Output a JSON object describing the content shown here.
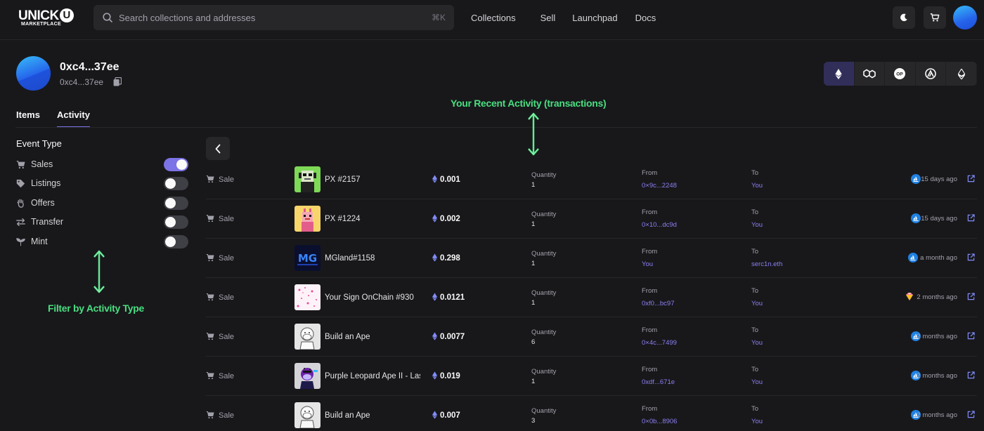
{
  "header": {
    "logo_main": "UNICK",
    "logo_u": "U",
    "logo_sub": "MARKETPLACE",
    "search_placeholder": "Search collections and addresses",
    "search_shortcut": "⌘K",
    "nav": [
      "Collections",
      "Sell",
      "Launchpad",
      "Docs"
    ]
  },
  "profile": {
    "address_main": "0xc4...37ee",
    "address_sub": "0xc4...37ee"
  },
  "chains": [
    {
      "icon": "ethereum-icon",
      "active": true
    },
    {
      "icon": "polygon-icon",
      "active": false
    },
    {
      "icon": "bnb-icon",
      "active": false
    },
    {
      "icon": "arbitrum-icon",
      "active": false
    },
    {
      "icon": "ethereum-icon",
      "active": false
    }
  ],
  "tabs": [
    "Items",
    "Activity"
  ],
  "sidebar": {
    "title": "Event Type",
    "filters": [
      {
        "label": "Sales",
        "icon": "cart-icon",
        "on": true
      },
      {
        "label": "Listings",
        "icon": "tag-icon",
        "on": false
      },
      {
        "label": "Offers",
        "icon": "hand-icon",
        "on": false
      },
      {
        "label": "Transfer",
        "icon": "transfer-icon",
        "on": false
      },
      {
        "label": "Mint",
        "icon": "sprout-icon",
        "on": false
      }
    ]
  },
  "annotations": {
    "activity": "Your Recent Activity (transactions)",
    "filter": "Filter by Activity Type"
  },
  "activity": {
    "quantity_label": "Quantity",
    "from_label": "From",
    "to_label": "To",
    "rows": [
      {
        "type": "Sale",
        "name": "PX #2157",
        "price": "0.001",
        "quantity": "1",
        "from": "0×9c...2248",
        "to": "You",
        "market": "opensea",
        "time": "15 days ago",
        "thumb": "px-green"
      },
      {
        "type": "Sale",
        "name": "PX #1224",
        "price": "0.002",
        "quantity": "1",
        "from": "0×10...dc9d",
        "to": "You",
        "market": "opensea",
        "time": "15 days ago",
        "thumb": "px-yellow"
      },
      {
        "type": "Sale",
        "name": "MGland#1158",
        "price": "0.298",
        "quantity": "1",
        "from": "You",
        "to": "serc1n.eth",
        "market": "opensea",
        "time": "a month ago",
        "thumb": "mgland"
      },
      {
        "type": "Sale",
        "name": "Your Sign OnChain #930",
        "price": "0.0121",
        "quantity": "1",
        "from": "0xf0...bc97",
        "to": "You",
        "market": "x2y2",
        "time": "2 months ago",
        "thumb": "sign"
      },
      {
        "type": "Sale",
        "name": "Build an Ape",
        "price": "0.0077",
        "quantity": "6",
        "from": "0×4c...7499",
        "to": "You",
        "market": "opensea",
        "time": "2 months ago",
        "thumb": "ape"
      },
      {
        "type": "Sale",
        "name": "Purple Leopard Ape II - Last",
        "price": "0.019",
        "quantity": "1",
        "from": "0xdf...671e",
        "to": "You",
        "market": "opensea",
        "time": "2 months ago",
        "thumb": "leopard"
      },
      {
        "type": "Sale",
        "name": "Build an Ape",
        "price": "0.007",
        "quantity": "3",
        "from": "0×0b...8906",
        "to": "You",
        "market": "opensea",
        "time": "2 months ago",
        "thumb": "ape"
      }
    ]
  }
}
